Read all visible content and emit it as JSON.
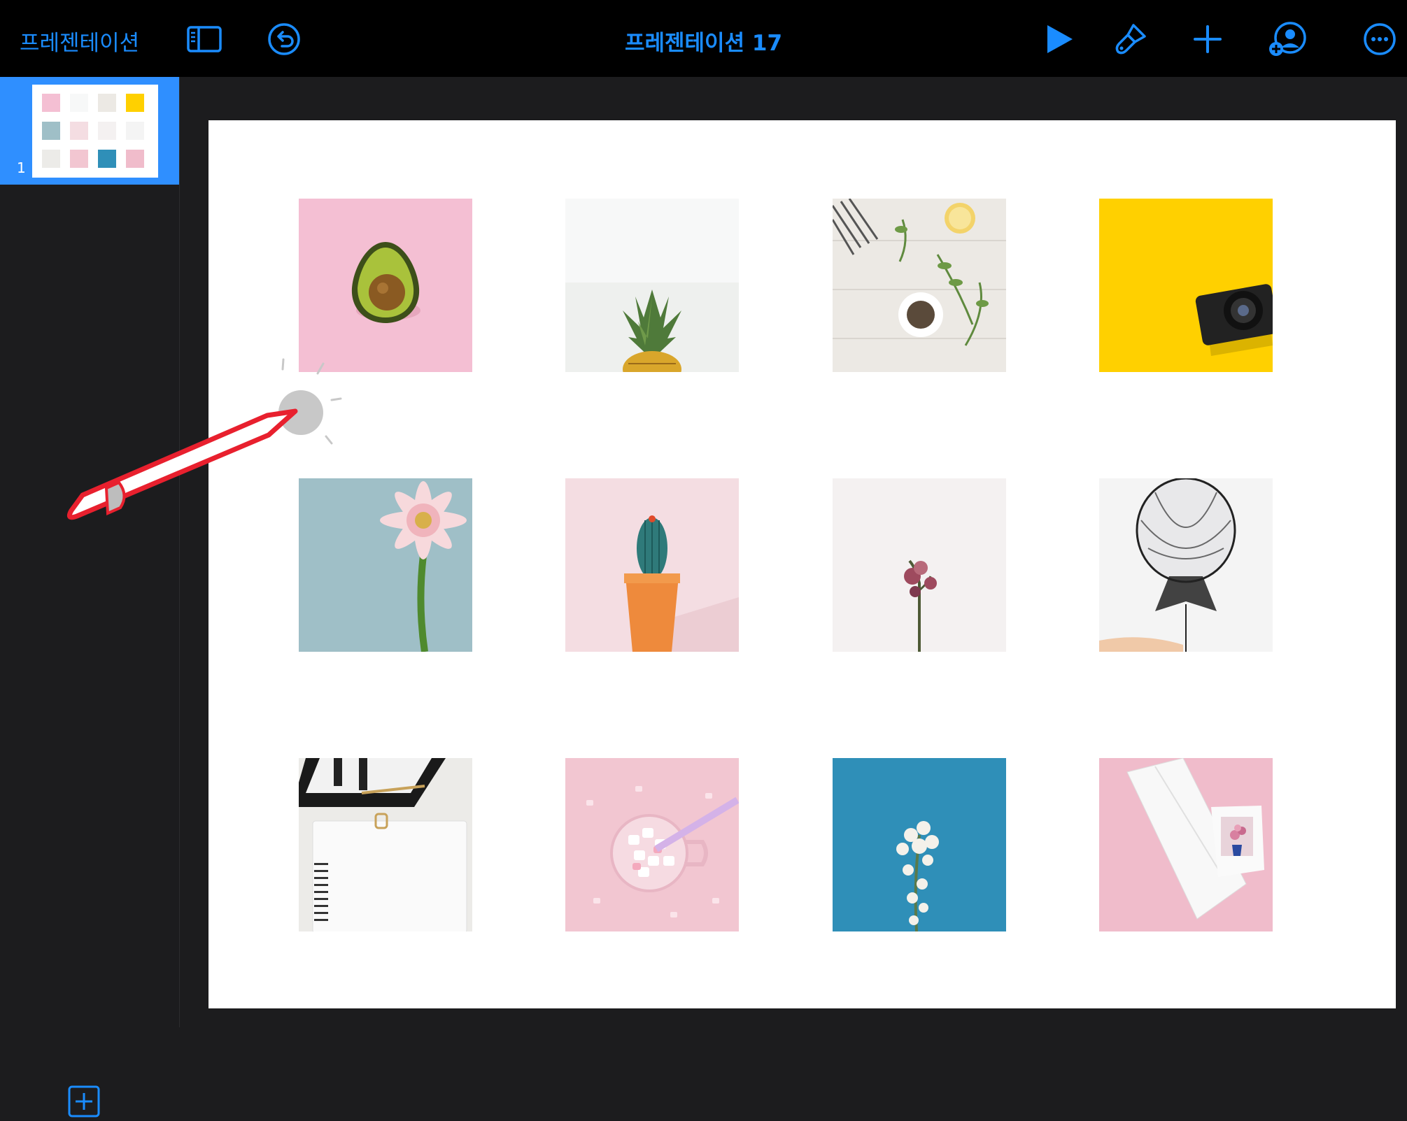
{
  "toolbar": {
    "back_label": "프레젠테이션",
    "title": "프레젠테이션 17",
    "accent_color": "#1a8cff",
    "icons": [
      "sidebar-toggle-icon",
      "undo-icon",
      "play-icon",
      "format-brush-icon",
      "add-icon",
      "collaborate-icon",
      "more-icon"
    ]
  },
  "sidebar": {
    "slides": [
      {
        "number": "1",
        "selected": true
      }
    ],
    "add_icon": "add-slide-icon"
  },
  "slide": {
    "photos": [
      {
        "subject": "avocado",
        "bg": "#f4bfd3"
      },
      {
        "subject": "pineapple",
        "bg": "#f7f8f8"
      },
      {
        "subject": "herbs-and-spices",
        "bg": "#ece9e4"
      },
      {
        "subject": "camera",
        "bg": "#ffd000"
      },
      {
        "subject": "gerbera-flower",
        "bg": "#9fbfc7"
      },
      {
        "subject": "cactus",
        "bg": "#f4dde2"
      },
      {
        "subject": "dried-rose",
        "bg": "#f4f1f1"
      },
      {
        "subject": "black-balloon",
        "bg": "#f4f4f4"
      },
      {
        "subject": "clipboard-notebook",
        "bg": "#ecebe8"
      },
      {
        "subject": "marshmallow-mug",
        "bg": "#f2c6d1"
      },
      {
        "subject": "white-blossom",
        "bg": "#2f8fb8"
      },
      {
        "subject": "sketchbook-photo",
        "bg": "#f0bccb"
      }
    ]
  },
  "overlay": {
    "pencil_icon": "apple-pencil-tap-icon"
  }
}
